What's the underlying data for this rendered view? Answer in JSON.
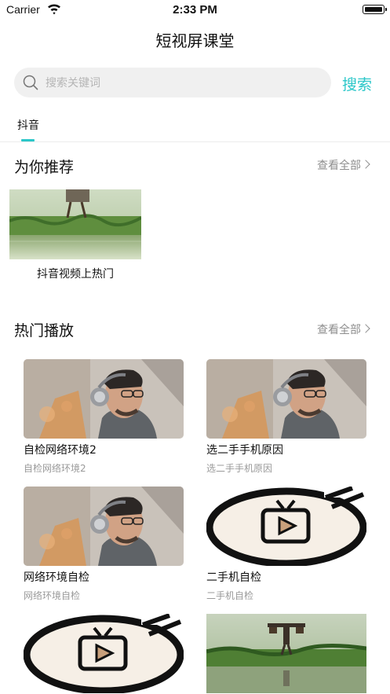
{
  "status_bar": {
    "carrier": "Carrier",
    "time": "2:33 PM"
  },
  "header": {
    "title": "短视屏课堂"
  },
  "search": {
    "placeholder": "搜索关键词",
    "button_label": "搜索"
  },
  "tabs": [
    {
      "label": "抖音",
      "active": true
    }
  ],
  "recommend": {
    "title": "为你推荐",
    "view_all": "查看全部",
    "items": [
      {
        "label": "抖音视频上热门",
        "image": "rice-field-farmer"
      }
    ]
  },
  "hot": {
    "title": "热门播放",
    "view_all": "查看全部",
    "items": [
      {
        "title": "自检网络环境2",
        "subtitle": "自检网络环境2",
        "image": "man-with-headphones"
      },
      {
        "title": "选二手手机原因",
        "subtitle": "选二手手机原因",
        "image": "man-with-headphones"
      },
      {
        "title": "网络环境自检",
        "subtitle": "网络环境自检",
        "image": "man-with-headphones"
      },
      {
        "title": "二手机自检",
        "subtitle": "二手机自检",
        "image": "tv-logo"
      },
      {
        "title": "",
        "subtitle": "",
        "image": "tv-logo"
      },
      {
        "title": "",
        "subtitle": "",
        "image": "rice-field-farmer"
      }
    ]
  },
  "colors": {
    "accent": "#2bc7c9",
    "muted": "#8e8e8e",
    "search_bg": "#f0f0f0"
  }
}
